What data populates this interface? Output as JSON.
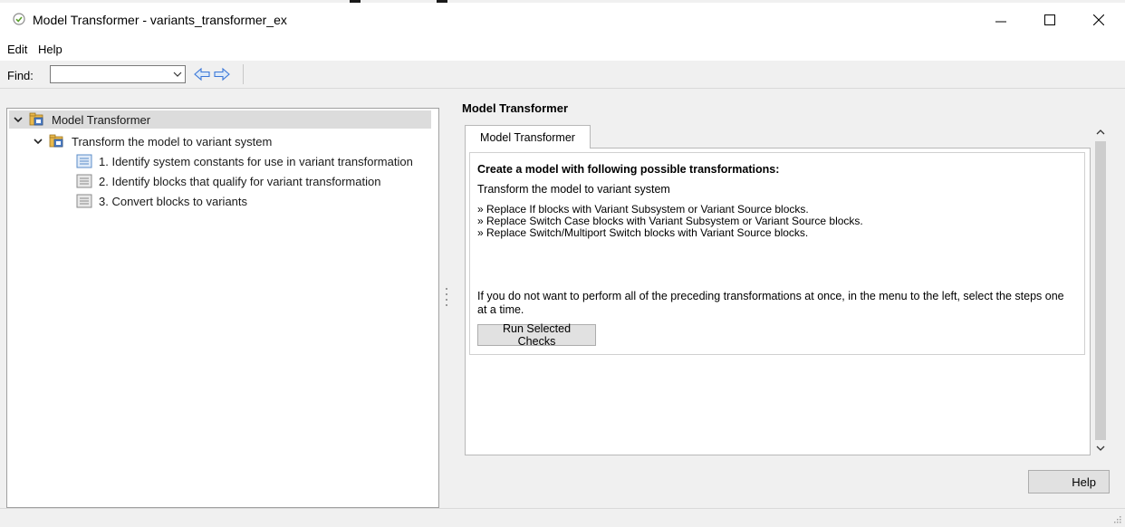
{
  "window": {
    "title": "Model Transformer - variants_transformer_ex"
  },
  "menu": {
    "items": [
      {
        "label": "Edit"
      },
      {
        "label": "Help"
      }
    ]
  },
  "toolbar": {
    "find_label": "Find:",
    "find_value": ""
  },
  "tree": {
    "root": {
      "label": "Model Transformer",
      "icon": "model-advisor-icon",
      "expanded": true,
      "selected": true
    },
    "group": {
      "label": "Transform the model to variant system",
      "icon": "folder-task-icon",
      "expanded": true
    },
    "checks": [
      {
        "label": "1. Identify system constants for use in variant transformation",
        "icon": "check-list-icon"
      },
      {
        "label": "2. Identify blocks that qualify for variant transformation",
        "icon": "check-list-icon"
      },
      {
        "label": "3. Convert blocks to variants",
        "icon": "check-list-icon"
      }
    ]
  },
  "main": {
    "heading": "Model Transformer",
    "tab_label": "Model Transformer",
    "card_heading": "Create a model with following possible transformations:",
    "card_subtitle": "Transform the model to variant system",
    "bullets": [
      "» Replace If blocks with Variant Subsystem or Variant Source blocks.",
      "» Replace Switch Case blocks with Variant Subsystem or Variant Source blocks.",
      "» Replace Switch/Multiport Switch blocks with Variant Source blocks."
    ],
    "note": "If you do not want to perform all of the preceding transformations at once, in the menu to the left, select the steps one at a time.",
    "run_button": "Run Selected Checks",
    "help_button": "Help"
  },
  "colors": {
    "accent_green": "#5aa02c",
    "icon_blue": "#3c78d8",
    "selection": "#dcdcdc"
  }
}
